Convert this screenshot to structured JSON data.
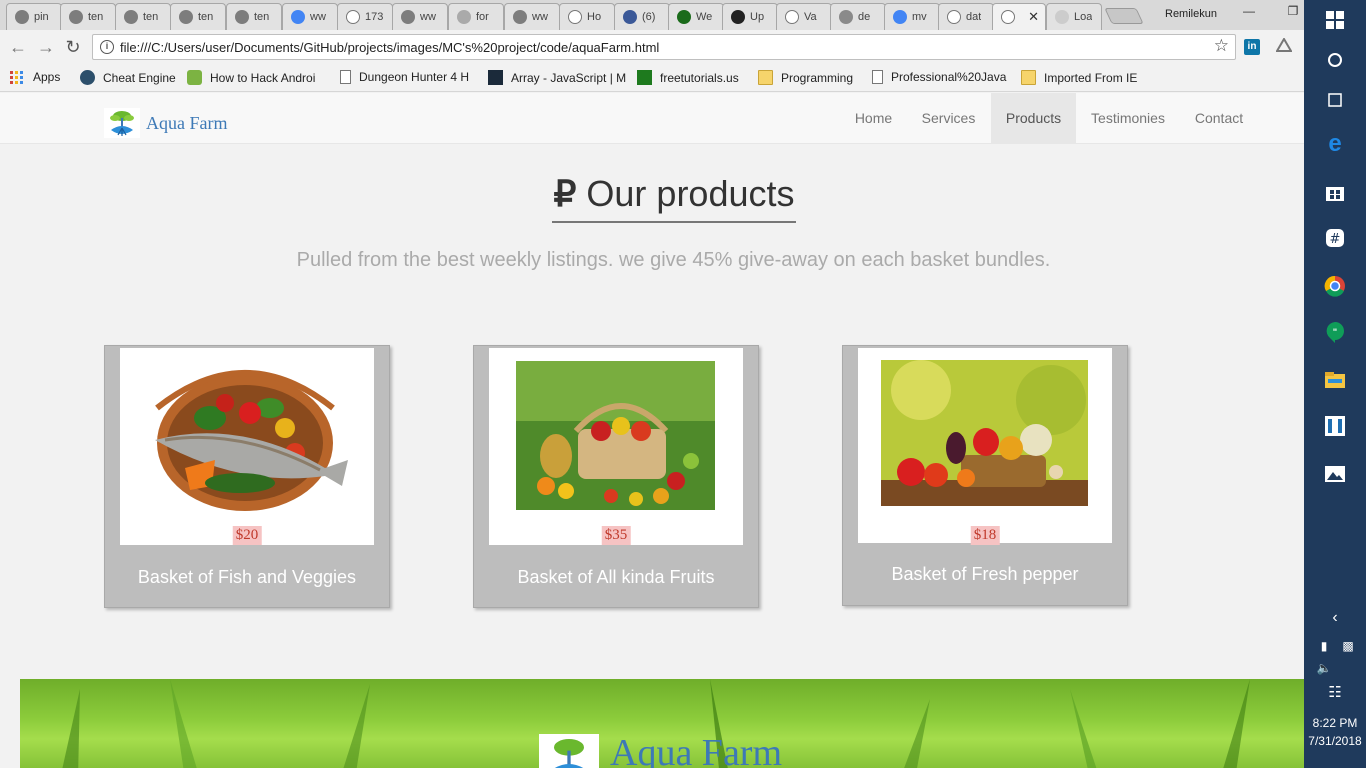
{
  "browser": {
    "tabs": [
      {
        "label": "pin",
        "icon": "pin-favicon",
        "color": "#7d7d7d"
      },
      {
        "label": "ten",
        "icon": "page-favicon",
        "color": "#7d7d7d"
      },
      {
        "label": "ten",
        "icon": "page-favicon",
        "color": "#7d7d7d"
      },
      {
        "label": "ten",
        "icon": "page-favicon",
        "color": "#7d7d7d"
      },
      {
        "label": "ten",
        "icon": "page-favicon",
        "color": "#7d7d7d"
      },
      {
        "label": "ww",
        "icon": "google-favicon",
        "color": "#4285f4"
      },
      {
        "label": "173",
        "icon": "document-favicon",
        "color": "#ffffff"
      },
      {
        "label": "ww",
        "icon": "link-favicon",
        "color": "#7d7d7d"
      },
      {
        "label": "for",
        "icon": "f-favicon",
        "color": "#aaaaaa"
      },
      {
        "label": "ww",
        "icon": "mail-favicon",
        "color": "#7d7d7d"
      },
      {
        "label": "Ho",
        "icon": "document-favicon",
        "color": "#ffffff"
      },
      {
        "label": "(6)",
        "icon": "facebook-favicon",
        "color": "#3b5998"
      },
      {
        "label": "We",
        "icon": "code-favicon",
        "color": "#1a6b1a"
      },
      {
        "label": "Up",
        "icon": "github-favicon",
        "color": "#222222"
      },
      {
        "label": "Va",
        "icon": "document-favicon",
        "color": "#ffffff"
      },
      {
        "label": "de",
        "icon": "facebook-favicon",
        "color": "#8a8a8a"
      },
      {
        "label": "mv",
        "icon": "google-favicon",
        "color": "#4285f4"
      },
      {
        "label": "dat",
        "icon": "document-favicon",
        "color": "#ffffff"
      },
      {
        "label": "",
        "icon": "document-favicon",
        "color": "#ffffff"
      },
      {
        "label": "Loa",
        "icon": "loading-favicon",
        "color": "#cccccc"
      }
    ],
    "profile_name": "Remilekun",
    "url": "file:///C:/Users/user/Documents/GitHub/projects/images/MC's%20project/code/aquaFarm.html",
    "bookmarks": [
      {
        "label": "Apps",
        "kind": "apps"
      },
      {
        "label": "Cheat Engine",
        "kind": "gear"
      },
      {
        "label": "How to Hack Androi",
        "kind": "android"
      },
      {
        "label": "Dungeon Hunter 4 H",
        "kind": "page"
      },
      {
        "label": "Array - JavaScript | M",
        "kind": "mdn"
      },
      {
        "label": "freetutorials.us",
        "kind": "ftu"
      },
      {
        "label": "Programming",
        "kind": "folder"
      },
      {
        "label": "Professional%20Java",
        "kind": "page"
      },
      {
        "label": "Imported From IE",
        "kind": "folder"
      }
    ]
  },
  "site": {
    "brand": "Aqua Farm",
    "nav": [
      "Home",
      "Services",
      "Products",
      "Testimonies",
      "Contact"
    ],
    "active_nav": "Products",
    "heading": "Our products",
    "heading_icon": "₽",
    "subheading": "Pulled from the best weekly listings. we give 45% give-away on each basket bundles.",
    "products": [
      {
        "price": "$20",
        "title": "Basket of Fish and Veggies"
      },
      {
        "price": "$35",
        "title": "Basket of All kinda Fruits"
      },
      {
        "price": "$18",
        "title": "Basket of Fresh pepper"
      }
    ],
    "footer_brand": "Aqua Farm"
  },
  "taskbar": {
    "time": "8:22 PM",
    "date": "7/31/2018"
  },
  "colors": {
    "brand_blue": "#3d79b6",
    "card_grey": "#bdbdbd",
    "price_bg": "#f6c3c3",
    "taskbar": "#1f3a5c"
  }
}
